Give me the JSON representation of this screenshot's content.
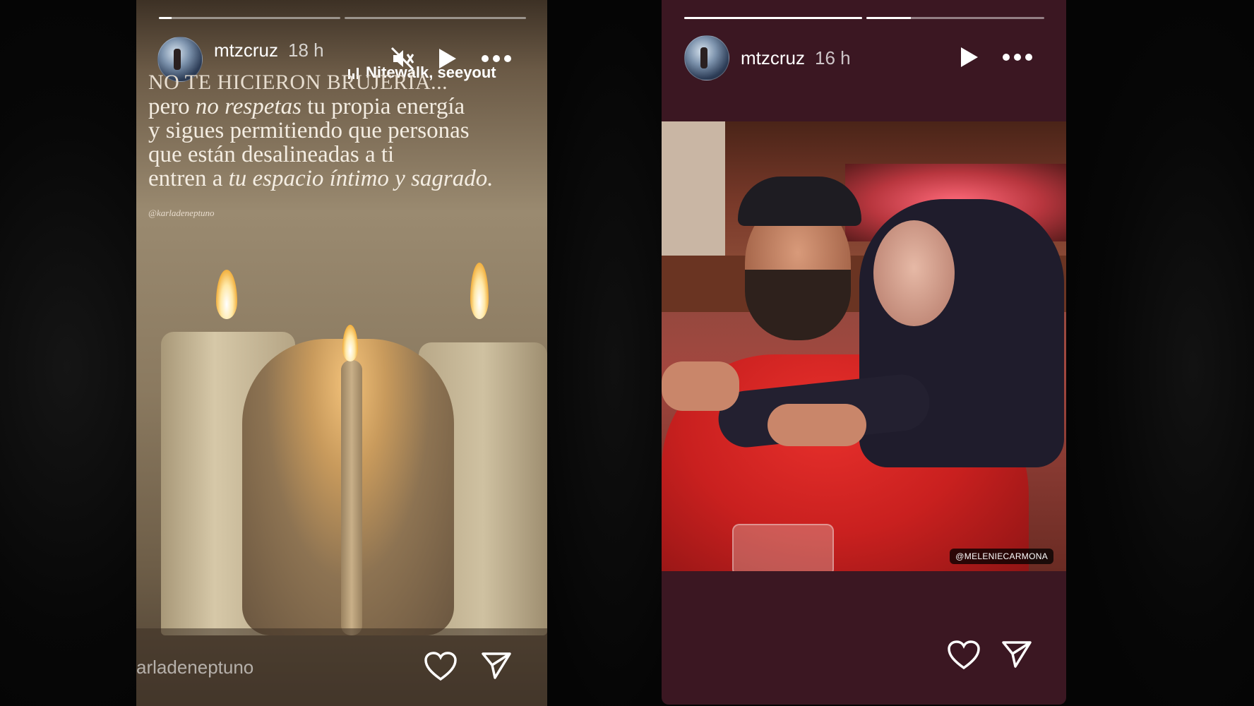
{
  "stories": [
    {
      "username": "mtzcruz",
      "time": "18 h",
      "music": "Nitewalk, seeyout",
      "quote": {
        "line1": "NO TE HICIERON BRUJERÍA...",
        "line2a": "pero ",
        "line2b": "no respetas",
        "line2c": " tu propia energía",
        "line3": "y sigues permitiendo que personas",
        "line4": "que están desalineadas a ti",
        "line5a": "entren a ",
        "line5b": "tu espacio íntimo y sagrado."
      },
      "credit": "@karladeneptuno",
      "reply_hint": "arladeneptuno",
      "progress": [
        0.07,
        0
      ]
    },
    {
      "username": "mtzcruz",
      "time": "16 h",
      "photo_tag": "@MELENIECARMONA",
      "progress": [
        1,
        0.25
      ]
    }
  ],
  "icons": [
    "mute-icon",
    "play-icon",
    "more-icon",
    "heart-icon",
    "send-icon"
  ]
}
